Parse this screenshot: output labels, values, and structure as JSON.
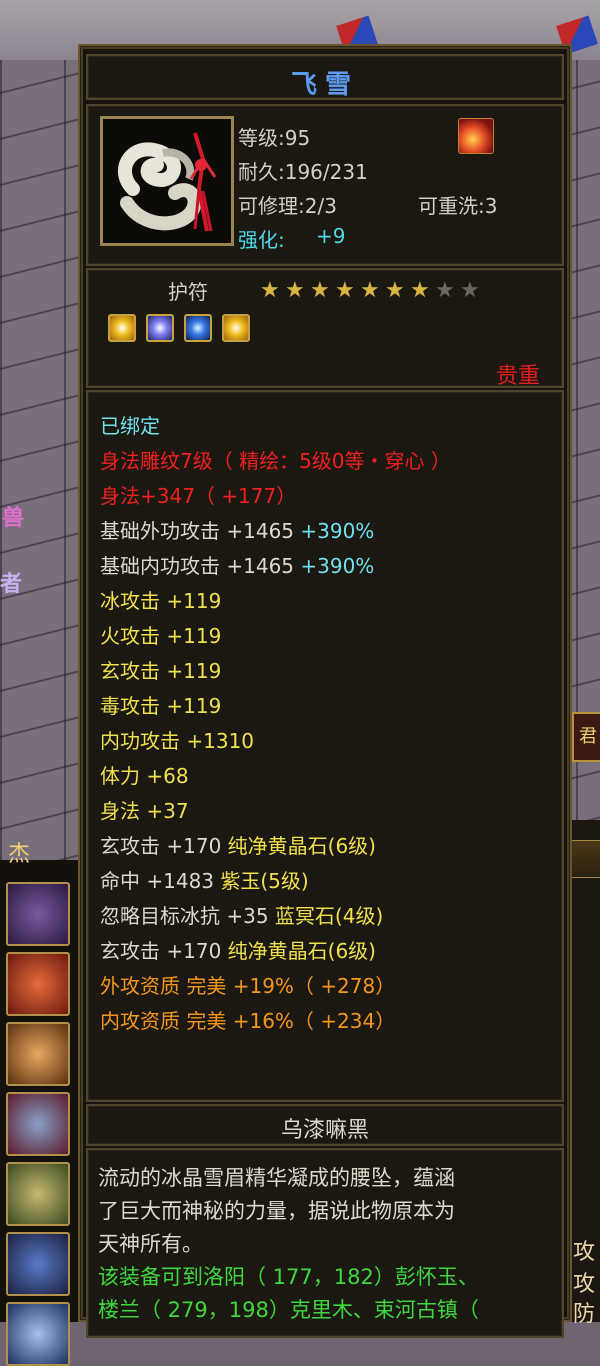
{
  "item": {
    "name": "飞雪",
    "level": "等级:95",
    "durability": "耐久:196/231",
    "repairable": "可修理:2/3",
    "rewashable": "可重洗:3",
    "enhance_label": "强化:",
    "enhance_value": "+9",
    "charm_label": "护符",
    "stars_filled": 7,
    "stars_total": 9,
    "rarity": "贵重",
    "dye": "乌漆嘛黑"
  },
  "attributes": [
    {
      "parts": [
        {
          "text": "已绑定",
          "color": "cyan"
        }
      ]
    },
    {
      "parts": [
        {
          "text": "身法雕纹7级（ 精绘：5级0等・穿心 ）",
          "color": "red"
        }
      ]
    },
    {
      "parts": [
        {
          "text": "身法+347（ +177）",
          "color": "red"
        }
      ]
    },
    {
      "parts": [
        {
          "text": "基础外功攻击 +1465 ",
          "color": "white"
        },
        {
          "text": "+390%",
          "color": "cyan"
        }
      ]
    },
    {
      "parts": [
        {
          "text": "基础内功攻击 +1465 ",
          "color": "white"
        },
        {
          "text": "+390%",
          "color": "cyan"
        }
      ]
    },
    {
      "parts": [
        {
          "text": "冰攻击 +119",
          "color": "yellow"
        }
      ]
    },
    {
      "parts": [
        {
          "text": "火攻击 +119",
          "color": "yellow"
        }
      ]
    },
    {
      "parts": [
        {
          "text": "玄攻击 +119",
          "color": "yellow"
        }
      ]
    },
    {
      "parts": [
        {
          "text": "毒攻击 +119",
          "color": "yellow"
        }
      ]
    },
    {
      "parts": [
        {
          "text": "内功攻击 +1310",
          "color": "yellow"
        }
      ]
    },
    {
      "parts": [
        {
          "text": "体力 +68",
          "color": "yellow"
        }
      ]
    },
    {
      "parts": [
        {
          "text": "身法 +37",
          "color": "yellow"
        }
      ]
    },
    {
      "parts": [
        {
          "text": "玄攻击 +170 ",
          "color": "white"
        },
        {
          "text": "纯净黄晶石(6级)",
          "color": "yellow"
        }
      ]
    },
    {
      "parts": [
        {
          "text": "命中 +1483 ",
          "color": "white"
        },
        {
          "text": "紫玉(5级)",
          "color": "yellow"
        }
      ]
    },
    {
      "parts": [
        {
          "text": "忽略目标冰抗 +35 ",
          "color": "white"
        },
        {
          "text": "蓝冥石(4级)",
          "color": "yellow"
        }
      ]
    },
    {
      "parts": [
        {
          "text": "玄攻击 +170 ",
          "color": "white"
        },
        {
          "text": "纯净黄晶石(6级)",
          "color": "yellow"
        }
      ]
    },
    {
      "parts": [
        {
          "text": "外攻资质  完美 +19%（ +278）",
          "color": "orange"
        }
      ]
    },
    {
      "parts": [
        {
          "text": "内攻资质  完美 +16%（ +234）",
          "color": "orange"
        }
      ]
    }
  ],
  "description": {
    "line1": "流动的冰晶雪眉精华凝成的腰坠，蕴涵",
    "line2": "了巨大而神秘的力量，据说此物原本为",
    "line3": "天神所有。",
    "line4": "该装备可到洛阳（ 177，182）彭怀玉、",
    "line5": "楼兰（ 279，198）克里木、束河古镇（"
  },
  "background": {
    "left_text_1": "兽",
    "left_text_2": "者",
    "left_panel_label": "杰",
    "right_labels": [
      "攻",
      "攻",
      "防"
    ]
  },
  "colors": {
    "title": "#5c9cf0",
    "rarity": "#e41c1c",
    "frame": "#6a5530",
    "panel": "#171410"
  }
}
